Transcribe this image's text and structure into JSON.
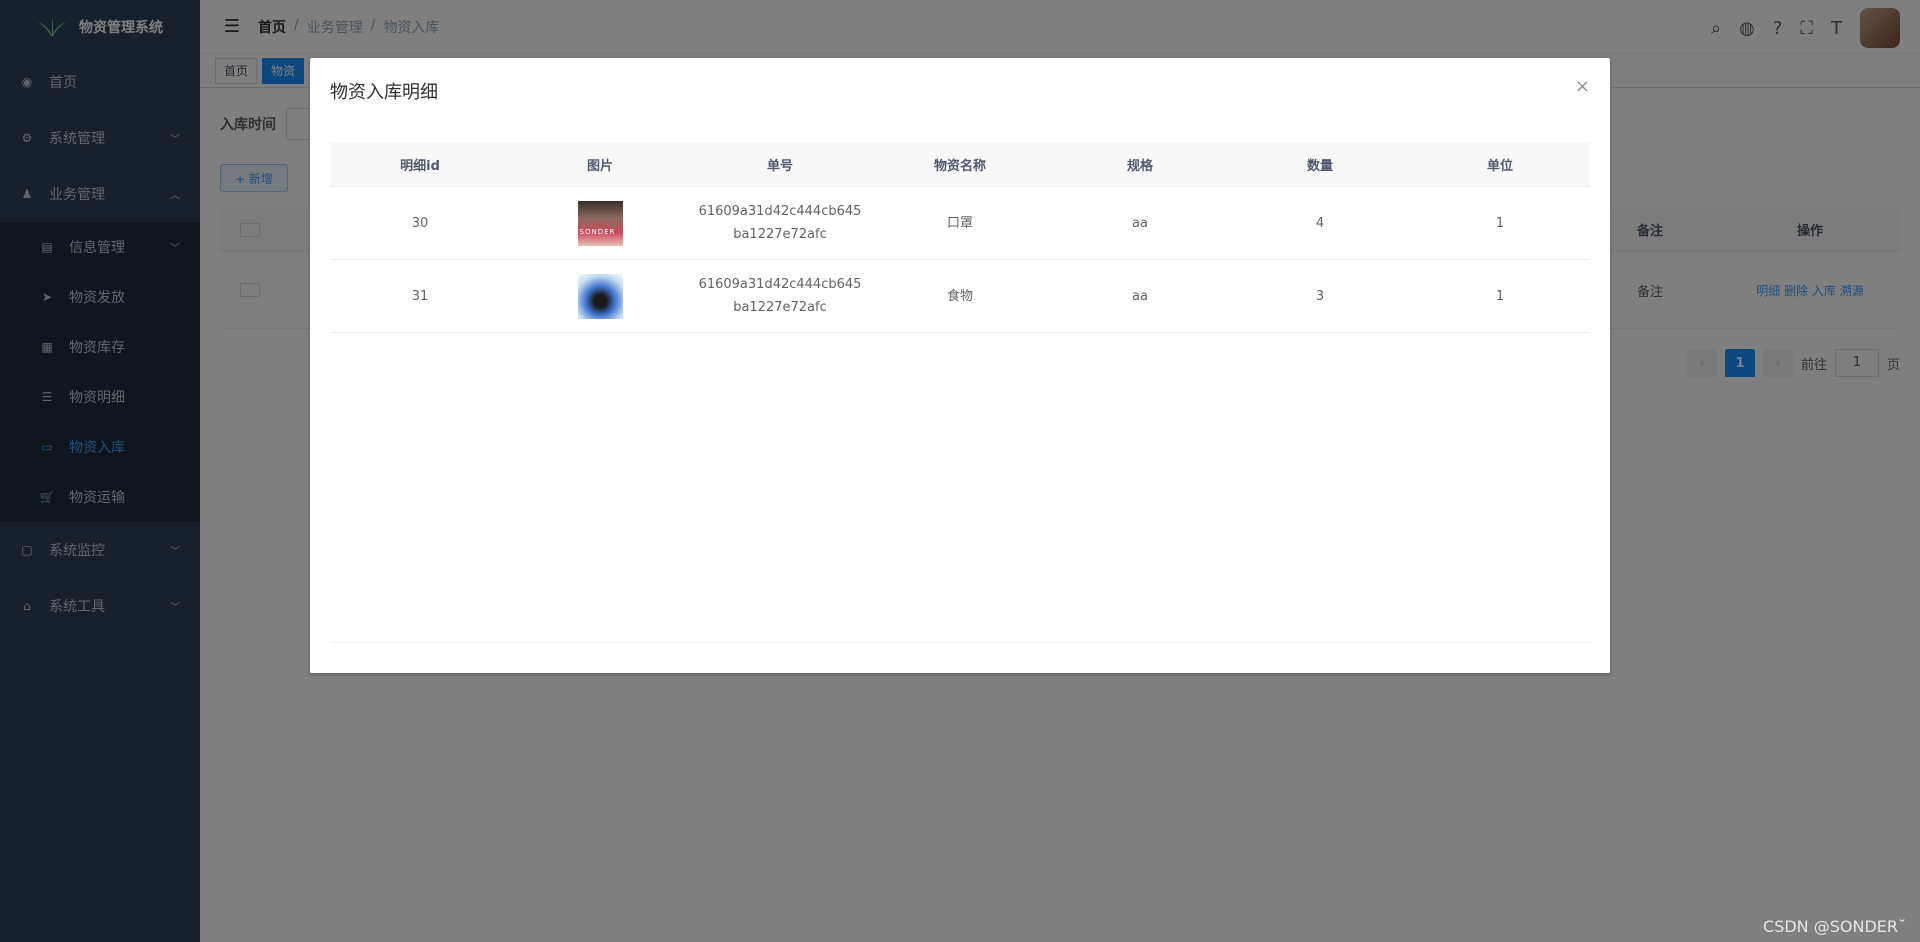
{
  "app": {
    "title": "物资管理系统"
  },
  "sidebar": {
    "items": [
      {
        "label": "首页",
        "icon": "dashboard-icon"
      },
      {
        "label": "系统管理",
        "icon": "gear-icon",
        "arrow": "﹀"
      },
      {
        "label": "业务管理",
        "icon": "user-icon",
        "arrow": "︿"
      },
      {
        "label": "系统监控",
        "icon": "monitor-icon",
        "arrow": "﹀"
      },
      {
        "label": "系统工具",
        "icon": "toolbox-icon",
        "arrow": "﹀"
      }
    ],
    "sub_items": [
      {
        "label": "信息管理",
        "icon": "document-icon",
        "arrow": "﹀"
      },
      {
        "label": "物资发放",
        "icon": "send-icon"
      },
      {
        "label": "物资库存",
        "icon": "inventory-icon"
      },
      {
        "label": "物资明细",
        "icon": "list-icon"
      },
      {
        "label": "物资入库",
        "icon": "box-icon",
        "active": true
      },
      {
        "label": "物资运输",
        "icon": "cart-icon"
      }
    ]
  },
  "breadcrumb": {
    "items": [
      "首页",
      "业务管理",
      "物资入库"
    ],
    "separator": "/"
  },
  "tags": {
    "items": [
      "首页",
      "物资"
    ]
  },
  "filter": {
    "label": "入库时间"
  },
  "toolbar": {
    "add_label": "+ 新增"
  },
  "table": {
    "headers": [
      "备注",
      "操作"
    ],
    "row": {
      "remark": "备注",
      "actions": [
        "明细",
        "删除",
        "入库",
        "溯源"
      ]
    }
  },
  "pager": {
    "current": "1",
    "goto_label": "前往",
    "goto_value": "1",
    "page_suffix": "页"
  },
  "dialog": {
    "title": "物资入库明细",
    "close": "×",
    "headers": [
      "明细id",
      "图片",
      "单号",
      "物资名称",
      "规格",
      "数量",
      "单位"
    ],
    "rows": [
      {
        "id": "30",
        "image_text": "SONDER",
        "order_line1": "61609a31d42c444cb645",
        "order_line2": "ba1227e72afc",
        "name": "口罩",
        "spec": "aa",
        "qty": "4",
        "unit": "1"
      },
      {
        "id": "31",
        "image_text": "",
        "order_line1": "61609a31d42c444cb645",
        "order_line2": "ba1227e72afc",
        "name": "食物",
        "spec": "aa",
        "qty": "3",
        "unit": "1"
      }
    ]
  },
  "watermark": "CSDN @SONDER˘",
  "colors": {
    "sidebar_bg": "#304156",
    "submenu_bg": "#1f2d3d",
    "active": "#409eff",
    "primary": "#1890ff"
  }
}
